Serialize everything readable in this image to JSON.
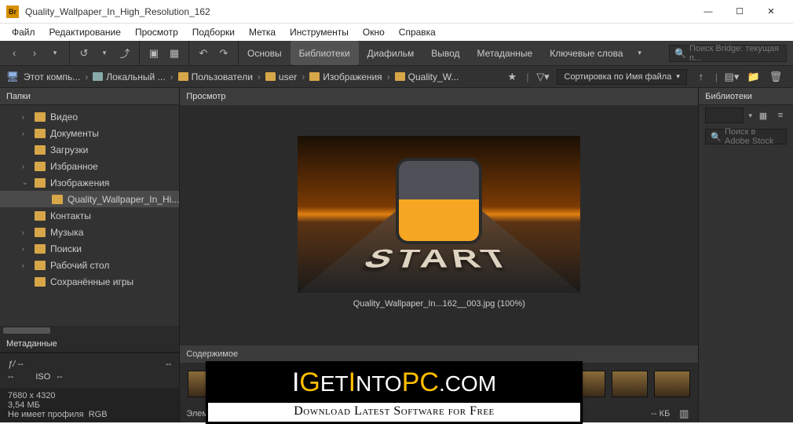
{
  "window": {
    "title": "Quality_Wallpaper_In_High_Resolution_162",
    "app_icon": "Br"
  },
  "menu": [
    "Файл",
    "Редактирование",
    "Просмотр",
    "Подборки",
    "Метка",
    "Инструменты",
    "Окно",
    "Справка"
  ],
  "tabs": {
    "items": [
      "Основы",
      "Библиотеки",
      "Диафильм",
      "Вывод",
      "Метаданные",
      "Ключевые слова"
    ],
    "active": 1
  },
  "search": {
    "placeholder": "Поиск Bridge: текущая п..."
  },
  "breadcrumbs": [
    {
      "label": "Этот компь..."
    },
    {
      "label": "Локальный ..."
    },
    {
      "label": "Пользователи"
    },
    {
      "label": "user"
    },
    {
      "label": "Изображения"
    },
    {
      "label": "Quality_W..."
    }
  ],
  "sort": {
    "label": "Сортировка по Имя файла"
  },
  "panels": {
    "folders": "Папки",
    "preview": "Просмотр",
    "metadata": "Метаданные",
    "content": "Содержимое",
    "libraries": "Библиотеки",
    "elements": "Элеме..."
  },
  "tree": [
    {
      "label": "Видео",
      "icon": "folder",
      "arrow": "›"
    },
    {
      "label": "Документы",
      "icon": "folder",
      "arrow": "›"
    },
    {
      "label": "Загрузки",
      "icon": "folder",
      "arrow": ""
    },
    {
      "label": "Избранное",
      "icon": "folder",
      "arrow": "›"
    },
    {
      "label": "Изображения",
      "icon": "folder",
      "arrow": "⌄",
      "expanded": true
    },
    {
      "label": "Quality_Wallpaper_In_Hi...",
      "icon": "folder",
      "arrow": "",
      "sub": true,
      "sel": true
    },
    {
      "label": "Контакты",
      "icon": "folder",
      "arrow": ""
    },
    {
      "label": "Музыка",
      "icon": "folder",
      "arrow": "›"
    },
    {
      "label": "Поиски",
      "icon": "folder",
      "arrow": "›"
    },
    {
      "label": "Рабочий стол",
      "icon": "folder",
      "arrow": "›"
    },
    {
      "label": "Сохранённые игры",
      "icon": "folder",
      "arrow": ""
    }
  ],
  "metadata": {
    "aperture": "ƒ/ --",
    "iso_label": "ISO",
    "iso_val": "--",
    "dash1": "--",
    "dash2": "--",
    "dimensions": "7680 x 4320",
    "size": "3,54 МБ",
    "profile": "Не имеет профиля",
    "color": "RGB"
  },
  "preview": {
    "caption": "Quality_Wallpaper_In...162__003.jpg (100%)",
    "start_text": "START"
  },
  "libraries": {
    "search_placeholder": "Поиск в Adobe Stock"
  },
  "footer": {
    "kb": "-- КБ"
  },
  "overlay": {
    "brand_pieces": [
      "I",
      "G",
      "ET",
      "I",
      "NTO",
      "PC",
      ".",
      "COM"
    ],
    "tagline": "Download Latest Software for Free"
  }
}
